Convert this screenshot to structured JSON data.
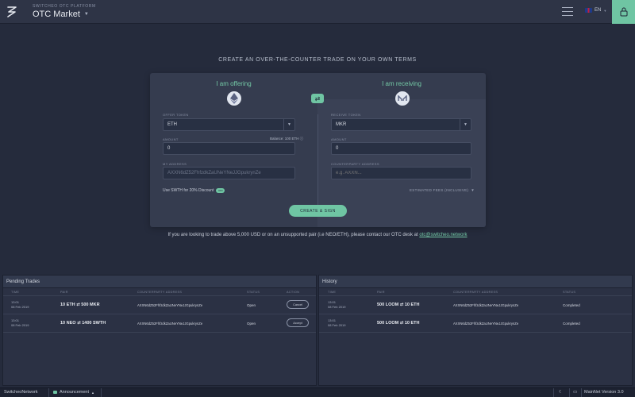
{
  "header": {
    "platform_label": "SWITCHEO OTC PLATFORM",
    "title": "OTC Market",
    "language": "EN"
  },
  "hero": {
    "title": "CREATE AN OVER-THE-COUNTER TRADE ON YOUR OWN TERMS"
  },
  "offer": {
    "heading": "I am offering",
    "token_label": "OFFER TOKEN",
    "token_value": "ETH",
    "amount_label": "AMOUNT",
    "amount_value": "0",
    "balance": "Balance: 100 ETH",
    "address_label": "MY ADDRESS",
    "address_value": "AXXN6dZ52FhfzdkZaUNeYNeJJGpukrynZe",
    "swth_discount": "Use SWTH for 20% Discount",
    "swth_toggle": "OFF"
  },
  "receive": {
    "heading": "I am receiving",
    "token_label": "RECEIVE TOKEN",
    "token_value": "MKR",
    "amount_label": "AMOUNT",
    "amount_value": "0",
    "counterparty_label": "COUNTERPARTY ADDRESS",
    "counterparty_placeholder": "e.g. AXXN...",
    "fees": "ESTIMATED FEES (INCLUSIVE)"
  },
  "create_button": "CREATE & SIGN",
  "note": {
    "text": "If you are looking to trade above 5,000 USD or on an unsupported pair (i.e NEO/ETH), please contact our OTC desk at",
    "email": "otc@switcheo.network"
  },
  "pending": {
    "title": "Pending Trades",
    "columns": [
      "TIME",
      "PAIR",
      "COUNTERPARTY ADDRESS",
      "STATUS",
      "ACTION"
    ],
    "rows": [
      {
        "time": "13:01",
        "date": "08 Feb 2019",
        "pair": "10 ETH ⇄ 500 MKR",
        "address": "AXXN6dZ52FhfzdkZaUNeYNeJJGpukrynZe",
        "status": "Open",
        "action": "Cancel"
      },
      {
        "time": "13:01",
        "date": "08 Feb 2019",
        "pair": "10 NEO ⇄ 1400 SWTH",
        "address": "AXXN6dZ52FhfzdkZaUNeYNeJJGpukrynZe",
        "status": "Open",
        "action": "Accept"
      }
    ]
  },
  "history": {
    "title": "History",
    "columns": [
      "TIME",
      "PAIR",
      "COUNTERPARTY ADDRESS",
      "STATUS"
    ],
    "rows": [
      {
        "time": "13:01",
        "date": "08 Feb 2019",
        "pair": "500 LOOM ⇄ 10 ETH",
        "address": "AXXN6dZ52FhfzdkZaUNeYNeJJGpukrynZe",
        "status": "Completed"
      },
      {
        "time": "13:01",
        "date": "08 Feb 2019",
        "pair": "500 LOOM ⇄ 10 ETH",
        "address": "AXXN6dZ52FhfzdkZaUNeYNeJJGpukrynZe",
        "status": "Completed"
      }
    ]
  },
  "footer": {
    "network": "SwitcheoNetwork",
    "announcement": "Announcement",
    "network_version": "MainNet Version 3.0"
  },
  "colors": {
    "accent": "#6fc5a3",
    "background": "#252b3c",
    "card": "#353c4f"
  }
}
